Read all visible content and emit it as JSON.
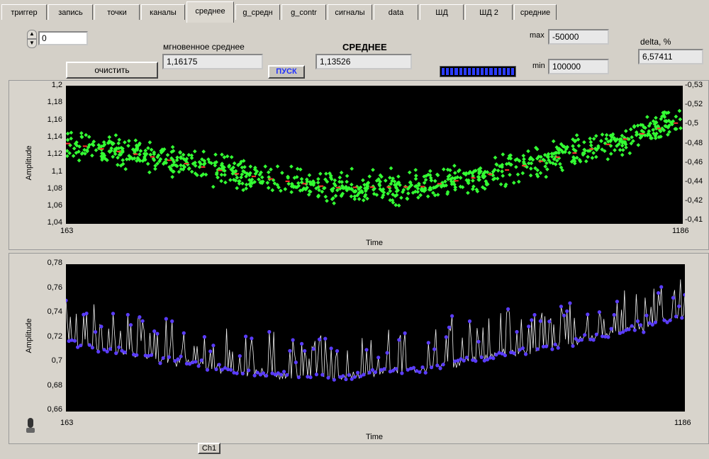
{
  "tabs": [
    "триггер",
    "запись",
    "точки",
    "каналы",
    "среднее",
    "g_средн",
    "g_contr",
    "сигналы",
    "data",
    "ШД",
    "ШД 2",
    "средние"
  ],
  "active_tab": 4,
  "controls": {
    "numeric_value": "0",
    "instant_label": "мгновенное среднее",
    "instant_value": "1,16175",
    "clear_label": "очистить",
    "start_label": "ПУСК",
    "avg_label": "СРЕДНЕЕ",
    "avg_value": "1,13526",
    "max_label": "max",
    "max_value": "-50000",
    "min_label": "min",
    "min_value": "100000",
    "delta_label": "delta, %",
    "delta_value": "6,57411"
  },
  "colors": {
    "plot_bg": "#000000",
    "series_green": "#33ff33",
    "series_blue": "#5a3cff",
    "progress_blue": "#2b3cff"
  },
  "graph1": {
    "ylabel": "Amplitude",
    "xlabel": "Time",
    "x_start": "163",
    "x_end": "1186",
    "y_ticks": [
      "1,2",
      "1,18",
      "1,16",
      "1,14",
      "1,12",
      "1,1",
      "1,08",
      "1,06",
      "1,04"
    ],
    "y2_ticks": [
      "-0,53",
      "-0,52",
      "-0,5",
      "-0,48",
      "-0,46",
      "-0,44",
      "-0,42",
      "-0,41"
    ]
  },
  "graph2": {
    "ylabel": "Amplitude",
    "xlabel": "Time",
    "x_start": "163",
    "x_end": "1186",
    "y_ticks": [
      "0,78",
      "0,76",
      "0,74",
      "0,72",
      "0,7",
      "0,68",
      "0,66"
    ],
    "legend": "Ch1"
  },
  "chart_data": [
    {
      "type": "scatter",
      "series": [
        {
          "name": "",
          "trend_points": [
            [
              163,
              1.133
            ],
            [
              300,
              1.118
            ],
            [
              450,
              1.097
            ],
            [
              600,
              1.082
            ],
            [
              750,
              1.083
            ],
            [
              850,
              1.095
            ],
            [
              950,
              1.113
            ],
            [
              1050,
              1.13
            ],
            [
              1186,
              1.16
            ]
          ]
        }
      ],
      "xlabel": "Time",
      "ylabel": "Amplitude",
      "xlim": [
        163,
        1186
      ],
      "ylim": [
        1.04,
        1.2
      ],
      "grid": false
    },
    {
      "type": "line",
      "series": [
        {
          "name": "Ch1",
          "trend_points": [
            [
              163,
              0.716
            ],
            [
              300,
              0.706
            ],
            [
              450,
              0.692
            ],
            [
              600,
              0.688
            ],
            [
              750,
              0.695
            ],
            [
              850,
              0.704
            ],
            [
              950,
              0.712
            ],
            [
              1050,
              0.722
            ],
            [
              1186,
              0.738
            ]
          ]
        }
      ],
      "xlabel": "Time",
      "ylabel": "Amplitude",
      "xlim": [
        163,
        1186
      ],
      "ylim": [
        0.66,
        0.78
      ],
      "grid": false
    }
  ]
}
